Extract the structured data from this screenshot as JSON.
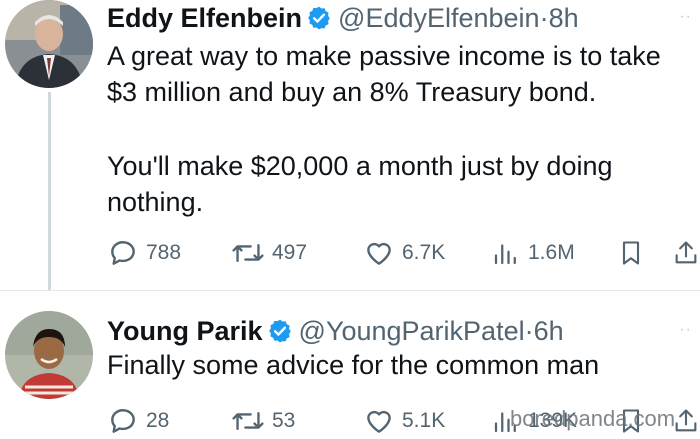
{
  "tweets": [
    {
      "name": "Eddy Elfenbein",
      "handle": "@EddyElfenbein",
      "separator": "·",
      "time": "8h",
      "lines": [
        "A great way to make passive income is to take",
        "$3 million and buy an 8% Treasury bond.",
        "You'll make $20,000 a month just by doing",
        "nothing."
      ],
      "stats": {
        "replies": "788",
        "reposts": "497",
        "likes": "6.7K",
        "views": "1.6M"
      },
      "icons": [
        "reply-icon",
        "repost-icon",
        "like-icon",
        "views-icon",
        "bookmark-icon",
        "share-icon"
      ]
    },
    {
      "name": "Young Parik",
      "handle": "@YoungParikPatel",
      "separator": "·",
      "time": "6h",
      "lines": [
        "Finally some advice for the common man"
      ],
      "stats": {
        "replies": "28",
        "reposts": "53",
        "likes": "5.1K",
        "views": "139K"
      },
      "icons": [
        "reply-icon",
        "repost-icon",
        "like-icon",
        "views-icon",
        "bookmark-icon",
        "share-icon"
      ]
    }
  ],
  "watermark": "boredpanda.com",
  "colors": {
    "verified": "#1d9bf0",
    "secondary_text": "#536471",
    "primary_text": "#0f1419"
  }
}
